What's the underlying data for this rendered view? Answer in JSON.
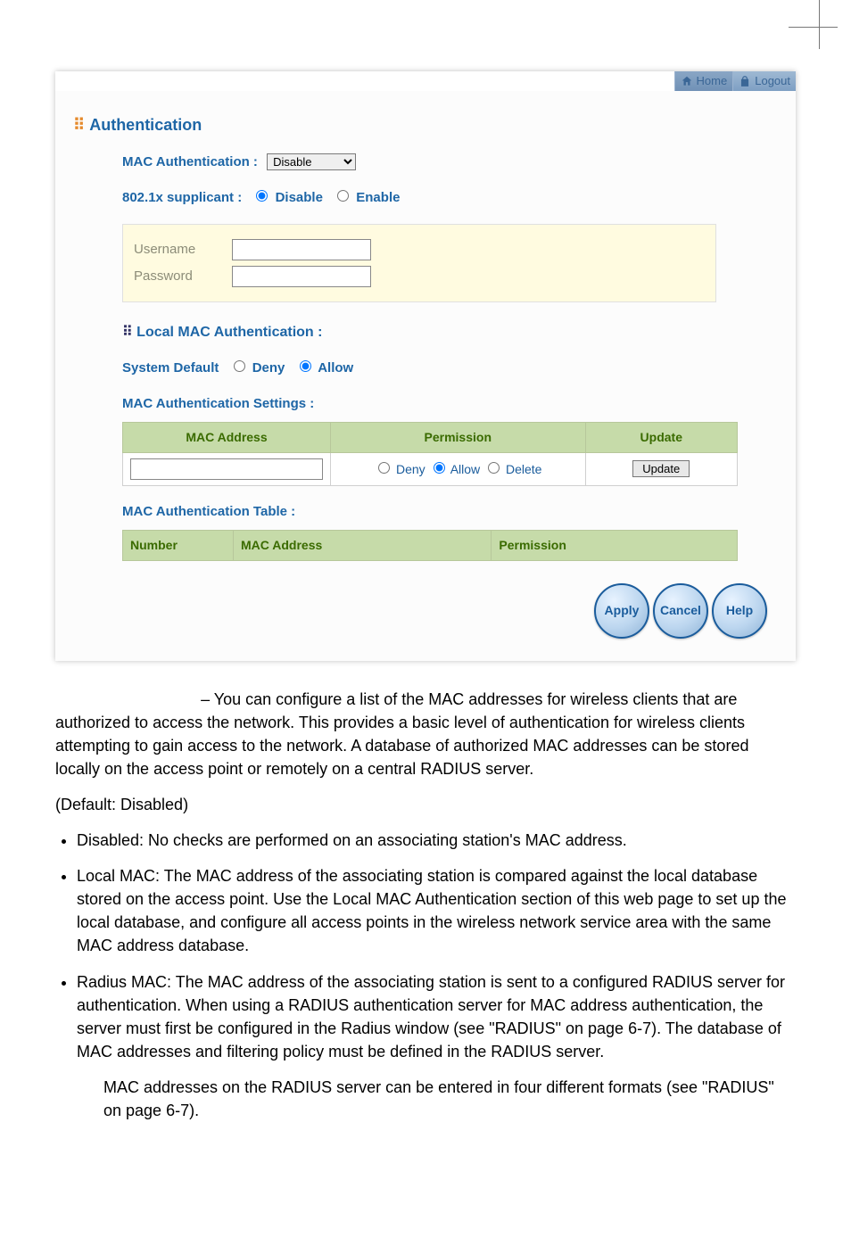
{
  "topbar": {
    "home_label": "Home",
    "logout_label": "Logout"
  },
  "panel": {
    "title": "Authentication",
    "mac_auth_label": "MAC Authentication :",
    "mac_auth_value": "Disable",
    "supplicant_label": "802.1x supplicant :",
    "supplicant_disable": "Disable",
    "supplicant_enable": "Enable",
    "username_label": "Username",
    "password_label": "Password",
    "local_mac_title": "Local MAC Authentication :",
    "system_default_label": "System Default",
    "deny_label": "Deny",
    "allow_label": "Allow",
    "mac_settings_label": "MAC Authentication Settings :",
    "settings_headers": {
      "mac": "MAC Address",
      "perm": "Permission",
      "update": "Update"
    },
    "perm_deny": "Deny",
    "perm_allow": "Allow",
    "perm_delete": "Delete",
    "update_btn": "Update",
    "mac_table_label": "MAC Authentication Table :",
    "table_headers": {
      "number": "Number",
      "mac": "MAC Address",
      "perm": "Permission"
    }
  },
  "footer_buttons": {
    "apply": "Apply",
    "cancel": "Cancel",
    "help": "Help"
  },
  "doc": {
    "para_start": " – You can configure a list of the MAC addresses for wireless clients that are authorized to access the network. This provides a basic level of authentication for wireless clients attempting to gain access to the network. A database of authorized MAC addresses can be stored locally on the access point or remotely on a central RADIUS server.",
    "default_line": "(Default: Disabled)",
    "bullet_disabled": "Disabled: No checks are performed on an associating station's MAC address.",
    "bullet_local": "Local MAC: The MAC address of the associating station is compared against the local database stored on the access point. Use the Local MAC Authentication section of this web page to set up the local database, and configure all access points in the wireless network service area with the same MAC address database.",
    "bullet_radius": "Radius MAC: The MAC address of the associating station is sent to a configured RADIUS server for authentication. When using a RADIUS authentication server for MAC address authentication, the server must first be configured in the Radius window (see \"RADIUS\" on page 6-7). The database of MAC addresses and filtering policy must be defined in the RADIUS server.",
    "note": "MAC addresses on the RADIUS server can be entered in four different formats (see \"RADIUS\" on page 6-7)."
  }
}
